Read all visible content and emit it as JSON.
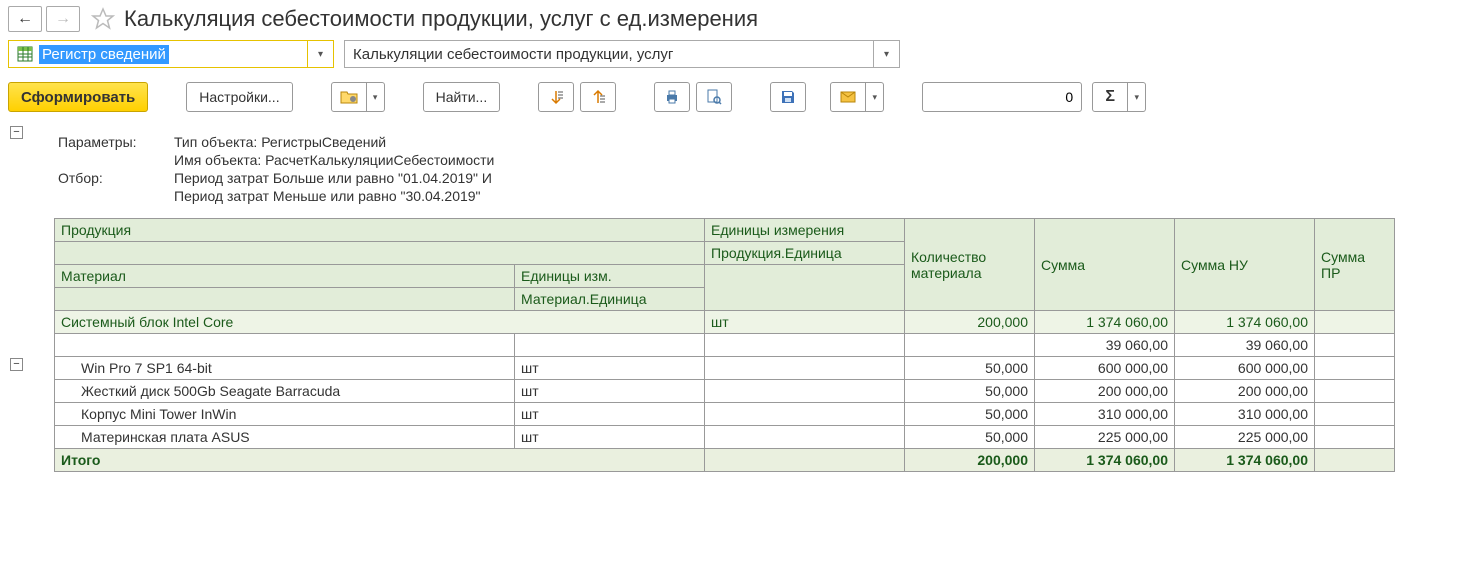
{
  "nav": {
    "back_icon": "←",
    "fwd_icon": "→",
    "star_icon": "☆"
  },
  "title": "Калькуляция себестоимости продукции, услуг с ед.измерения",
  "selectors": {
    "type_label": "Регистр сведений",
    "object_label": "Калькуляции себестоимости продукции, услуг"
  },
  "toolbar": {
    "generate": "Сформировать",
    "settings": "Настройки...",
    "find": "Найти...",
    "num_value": "0",
    "sigma": "Σ"
  },
  "params": {
    "params_label": "Параметры:",
    "type_line": "Тип объекта: РегистрыСведений",
    "name_line": "Имя объекта: РасчетКалькуляцииСебестоимости",
    "filter_label": "Отбор:",
    "filter_line1": "Период затрат Больше или равно \"01.04.2019\" И",
    "filter_line2": "Период затрат Меньше или равно \"30.04.2019\""
  },
  "headers": {
    "product": "Продукция",
    "unit": "Единицы измерения",
    "prod_unit": "Продукция.Единица",
    "material": "Материал",
    "mat_unit_h": "Единицы изм.",
    "mat_unit": "Материал.Единица",
    "qty": "Количество материала",
    "sum": "Сумма",
    "sum_nu": "Сумма НУ",
    "sum_pr": "Сумма ПР"
  },
  "product_row": {
    "name": "Системный блок Intel Core",
    "unit": "шт",
    "qty": "200,000",
    "sum": "1 374 060,00",
    "sum_nu": "1 374 060,00"
  },
  "blank_row": {
    "sum": "39 060,00",
    "sum_nu": "39 060,00"
  },
  "materials": [
    {
      "name": "Win Pro 7 SP1 64-bit",
      "unit": "шт",
      "qty": "50,000",
      "sum": "600 000,00",
      "sum_nu": "600 000,00"
    },
    {
      "name": "Жесткий диск 500Gb Seagate Barracuda",
      "unit": "шт",
      "qty": "50,000",
      "sum": "200 000,00",
      "sum_nu": "200 000,00"
    },
    {
      "name": "Корпус Mini Tower InWin",
      "unit": "шт",
      "qty": "50,000",
      "sum": "310 000,00",
      "sum_nu": "310 000,00"
    },
    {
      "name": "Материнская плата ASUS",
      "unit": "шт",
      "qty": "50,000",
      "sum": "225 000,00",
      "sum_nu": "225 000,00"
    }
  ],
  "total": {
    "label": "Итого",
    "qty": "200,000",
    "sum": "1 374 060,00",
    "sum_nu": "1 374 060,00"
  }
}
